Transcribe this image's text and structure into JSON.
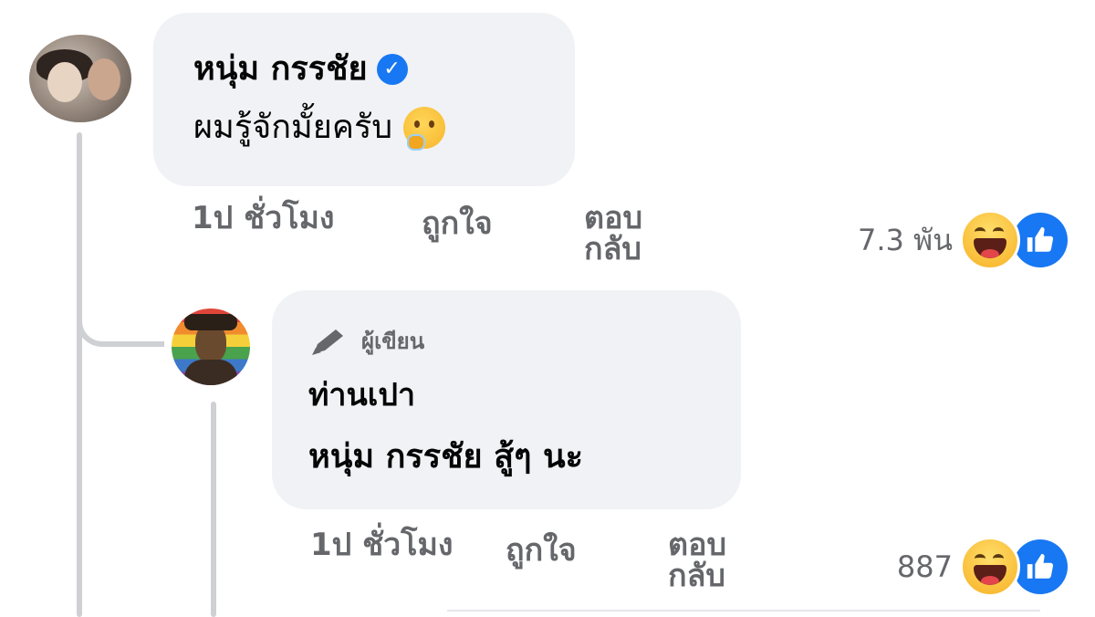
{
  "comment": {
    "author": "หนุ่ม กรรชัย",
    "verified": true,
    "text": "ผมรู้จักมั้ยครับ",
    "text_emoji": "thinking-face-emoji",
    "time": "1ป ชั่วโมง",
    "like_label": "ถูกใจ",
    "reply_label": "ตอบกลับ",
    "reaction_count": "7.3 พัน",
    "reactions": [
      "haha-icon",
      "like-icon"
    ]
  },
  "reply": {
    "badge": "ผู้เขียน",
    "badge_icon": "pen-icon",
    "author": "ท่านเปา",
    "text": "หนุ่ม กรรชัย สู้ๆ นะ",
    "time": "1ป ชั่วโมง",
    "like_label": "ถูกใจ",
    "reply_label": "ตอบกลับ",
    "reaction_count": "887",
    "reactions": [
      "haha-icon",
      "like-icon"
    ]
  },
  "colors": {
    "bubble": "#f0f2f5",
    "meta_text": "#65676b",
    "facebook_blue": "#1877f2",
    "thread_line": "#ced0d4"
  }
}
